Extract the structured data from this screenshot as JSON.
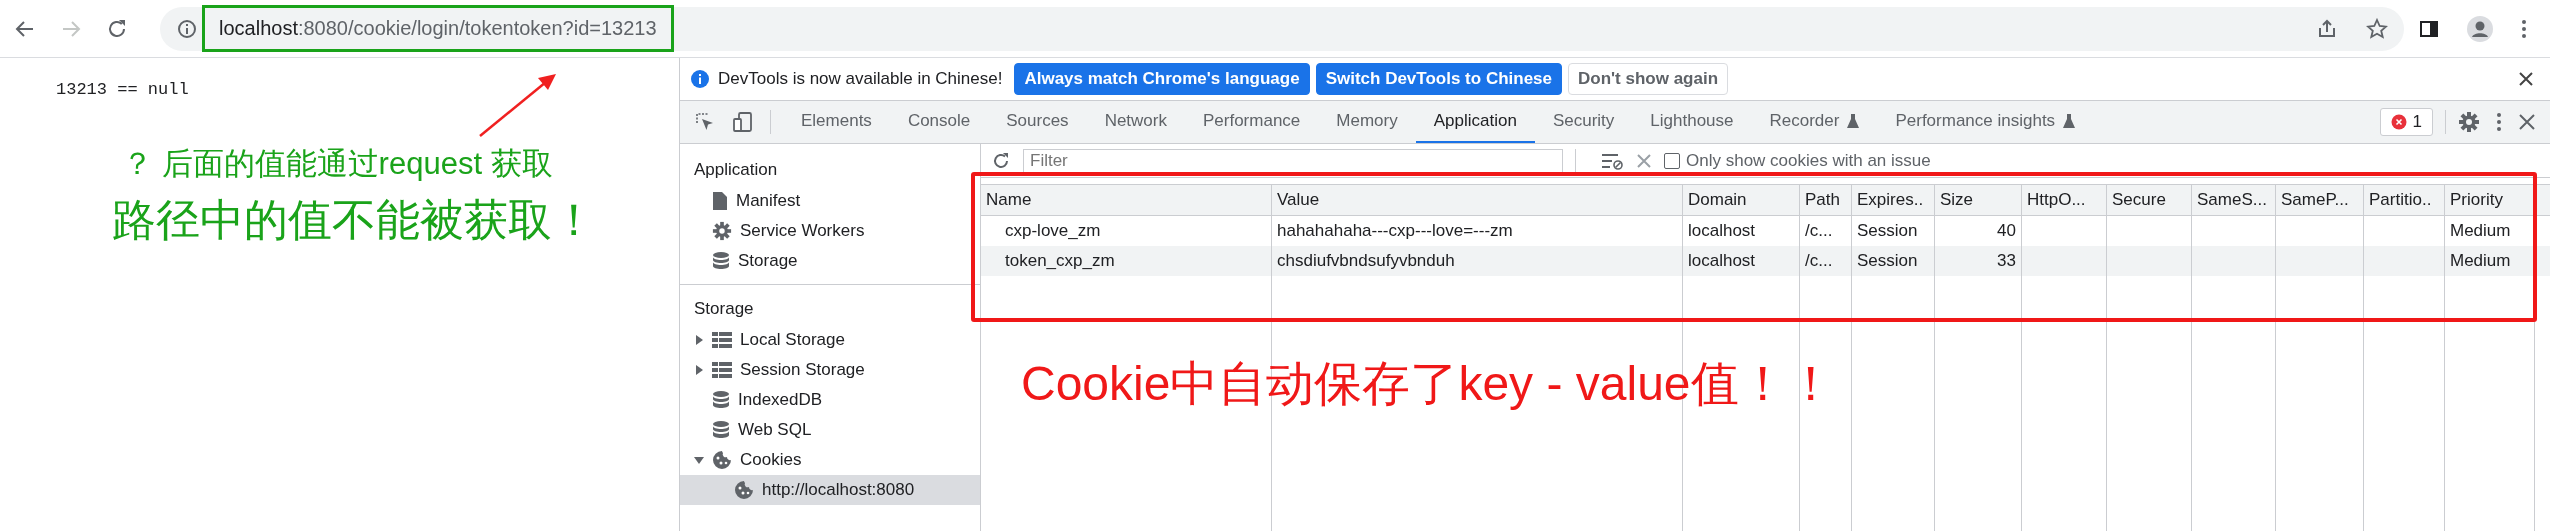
{
  "browser": {
    "url_host": "localhost",
    "url_rest": ":8080/cookie/login/tokentoken?id=13213",
    "forward_disabled": true
  },
  "page": {
    "output": "13213 == null"
  },
  "annotations": {
    "note_question": "？ 后面的值能通过request 获取",
    "note_path": "路径中的值不能被获取！",
    "note_cookie": "Cookie中自动保存了key - value值！！"
  },
  "infobar": {
    "message": "DevTools is now available in Chinese!",
    "buttons": [
      {
        "label": "Always match Chrome's language",
        "kind": "primary"
      },
      {
        "label": "Switch DevTools to Chinese",
        "kind": "primary"
      },
      {
        "label": "Don't show again",
        "kind": "secondary"
      }
    ]
  },
  "tabs": [
    {
      "label": "Elements",
      "selected": false,
      "experimental": false
    },
    {
      "label": "Console",
      "selected": false,
      "experimental": false
    },
    {
      "label": "Sources",
      "selected": false,
      "experimental": false
    },
    {
      "label": "Network",
      "selected": false,
      "experimental": false
    },
    {
      "label": "Performance",
      "selected": false,
      "experimental": false
    },
    {
      "label": "Memory",
      "selected": false,
      "experimental": false
    },
    {
      "label": "Application",
      "selected": true,
      "experimental": false
    },
    {
      "label": "Security",
      "selected": false,
      "experimental": false
    },
    {
      "label": "Lighthouse",
      "selected": false,
      "experimental": false
    },
    {
      "label": "Recorder",
      "selected": false,
      "experimental": true
    },
    {
      "label": "Performance insights",
      "selected": false,
      "experimental": true
    }
  ],
  "error_count": "1",
  "sidebar": {
    "sections": [
      {
        "title": "Application",
        "items": [
          {
            "label": "Manifest",
            "kind": "leaf",
            "selected": false
          },
          {
            "label": "Service Workers",
            "kind": "leaf",
            "selected": false
          },
          {
            "label": "Storage",
            "kind": "leaf",
            "selected": false
          }
        ]
      },
      {
        "title": "Storage",
        "items": [
          {
            "label": "Local Storage",
            "kind": "tree",
            "expanded": false,
            "selected": false
          },
          {
            "label": "Session Storage",
            "kind": "tree",
            "expanded": false,
            "selected": false
          },
          {
            "label": "IndexedDB",
            "kind": "leaf",
            "selected": false
          },
          {
            "label": "Web SQL",
            "kind": "leaf",
            "selected": false
          },
          {
            "label": "Cookies",
            "kind": "tree",
            "expanded": true,
            "selected": false,
            "children": [
              {
                "label": "http://localhost:8080",
                "kind": "leaf",
                "selected": true
              }
            ]
          }
        ]
      }
    ]
  },
  "filter": {
    "placeholder": "Filter",
    "checkbox_label": "Only show cookies with an issue",
    "checked": false
  },
  "table": {
    "columns": [
      {
        "label": "Name"
      },
      {
        "label": "Value"
      },
      {
        "label": "Domain"
      },
      {
        "label": "Path"
      },
      {
        "label": "Expires.."
      },
      {
        "label": "Size"
      },
      {
        "label": "HttpO..."
      },
      {
        "label": "Secure"
      },
      {
        "label": "SameS..."
      },
      {
        "label": "SameP..."
      },
      {
        "label": "Partitio.."
      },
      {
        "label": "Priority"
      }
    ],
    "rows": [
      {
        "selected": false,
        "cells": [
          "cxp-love_zm",
          "hahahahaha---cxp---love=---zm",
          "localhost",
          "/c...",
          "Session",
          "40",
          null,
          null,
          null,
          null,
          null,
          "Medium"
        ]
      },
      {
        "selected": false,
        "cells": [
          "token_cxp_zm",
          "chsdiufvbndsufyvbnduh",
          "localhost",
          "/c...",
          "Session",
          "33",
          null,
          null,
          null,
          null,
          null,
          "Medium"
        ]
      }
    ]
  }
}
